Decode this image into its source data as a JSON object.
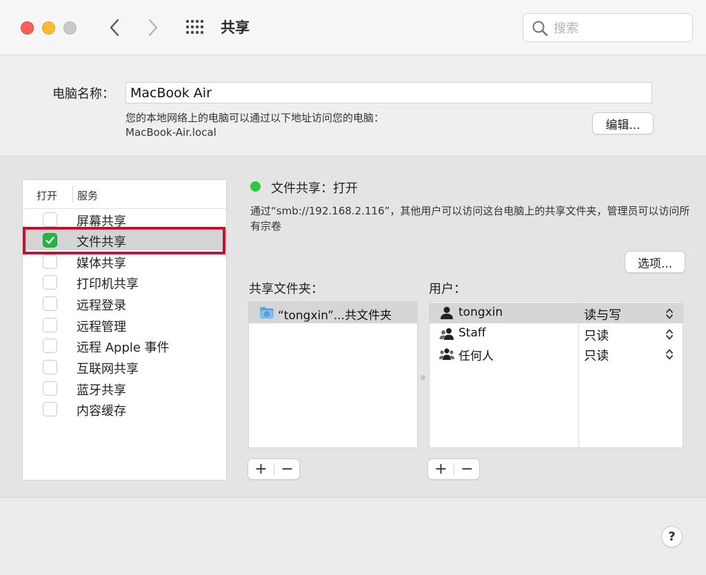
{
  "window": {
    "title": "共享"
  },
  "search": {
    "placeholder": "搜索"
  },
  "computer_name": {
    "label": "电脑名称：",
    "value": "MacBook Air",
    "description_line1": "您的本地网络上的电脑可以通过以下地址访问您的电脑：",
    "description_line2": "MacBook-Air.local",
    "edit_label": "编辑..."
  },
  "services": {
    "header_on": "打开",
    "header_service": "服务",
    "items": [
      {
        "label": "屏幕共享",
        "checked": false,
        "selected": false
      },
      {
        "label": "文件共享",
        "checked": true,
        "selected": true
      },
      {
        "label": "媒体共享",
        "checked": false,
        "selected": false
      },
      {
        "label": "打印机共享",
        "checked": false,
        "selected": false
      },
      {
        "label": "远程登录",
        "checked": false,
        "selected": false
      },
      {
        "label": "远程管理",
        "checked": false,
        "selected": false
      },
      {
        "label": "远程 Apple 事件",
        "checked": false,
        "selected": false
      },
      {
        "label": "互联网共享",
        "checked": false,
        "selected": false
      },
      {
        "label": "蓝牙共享",
        "checked": false,
        "selected": false
      },
      {
        "label": "内容缓存",
        "checked": false,
        "selected": false
      }
    ]
  },
  "status": {
    "color": "#2ec840",
    "text": "文件共享：打开",
    "description": "通过“smb://192.168.2.116”，其他用户可以访问这台电脑上的共享文件夹，管理员可以访问所有宗卷"
  },
  "options_label": "选项...",
  "shared_folders": {
    "label": "共享文件夹：",
    "items": [
      {
        "name": "“tongxin”...共文件夹"
      }
    ]
  },
  "users": {
    "label": "用户：",
    "items": [
      {
        "name": "tongxin",
        "permission": "读与写",
        "icon": "single-user-icon"
      },
      {
        "name": "Staff",
        "permission": "只读",
        "icon": "group-user-icon"
      },
      {
        "name": "任何人",
        "permission": "只读",
        "icon": "everyone-icon"
      }
    ]
  },
  "buttons": {
    "plus": "+",
    "minus": "−",
    "help": "?"
  }
}
